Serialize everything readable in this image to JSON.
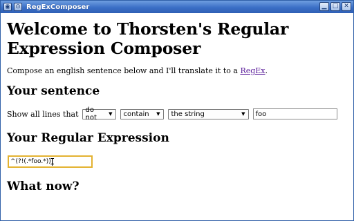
{
  "window": {
    "title": "RegExComposer",
    "sys_icon": "◉",
    "sys_icon2": "⊙",
    "minimize_icon": "▁",
    "maximize_icon": "□",
    "close_icon": "✕"
  },
  "page": {
    "heading": "Welcome to Thorsten's Regular Expression Composer",
    "intro_text": "Compose an english sentence below and I'll translate it to a ",
    "intro_link": "RegEx",
    "intro_end": "."
  },
  "sentence": {
    "heading": "Your sentence",
    "label": "Show all lines that",
    "select_negation": "do not",
    "select_verb": "contain",
    "select_object": "the string",
    "input_value": "foo",
    "dropdown_arrow": "▼"
  },
  "regex": {
    "heading": "Your Regular Expression",
    "value": "^(?!(.*foo.*))",
    "cursor_glyph": "I"
  },
  "next": {
    "heading": "What now?"
  },
  "colors": {
    "titlebar": "#3b6fc6",
    "link": "#5a1c9a",
    "focus_border": "#e3b230"
  }
}
